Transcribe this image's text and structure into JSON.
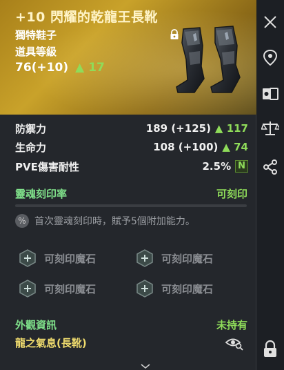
{
  "item": {
    "title": "+10 閃耀的乾龍王長靴",
    "type": "獨特鞋子",
    "level_label": "道具等級",
    "level_value": "76(+10)",
    "level_delta": "17"
  },
  "stats": [
    {
      "label": "防禦力",
      "value": "189 (+125)",
      "delta": "117"
    },
    {
      "label": "生命力",
      "value": "108 (+100)",
      "delta": "74"
    },
    {
      "label": "PVE傷害耐性",
      "value": "2.5%",
      "badge": "N"
    }
  ],
  "soul_engraving": {
    "label": "靈魂刻印率",
    "status": "可刻印",
    "note": "首次靈魂刻印時，賦予5個附加能力。"
  },
  "slots": [
    {
      "label": "可刻印魔石"
    },
    {
      "label": "可刻印魔石"
    },
    {
      "label": "可刻印魔石"
    },
    {
      "label": "可刻印魔石"
    }
  ],
  "appearance": {
    "label": "外觀資訊",
    "status": "未持有",
    "name": "龍之氣息(長靴)"
  },
  "sidebar": {
    "icons": [
      "close-icon",
      "location-pin-icon",
      "compare-cards-icon",
      "scales-icon",
      "share-icon",
      "lock-icon"
    ]
  },
  "colors": {
    "header_gold": "#c9a22a",
    "green": "#8fdc5a",
    "gold_text": "#f0dc6e",
    "panel_bg": "#24272c"
  }
}
